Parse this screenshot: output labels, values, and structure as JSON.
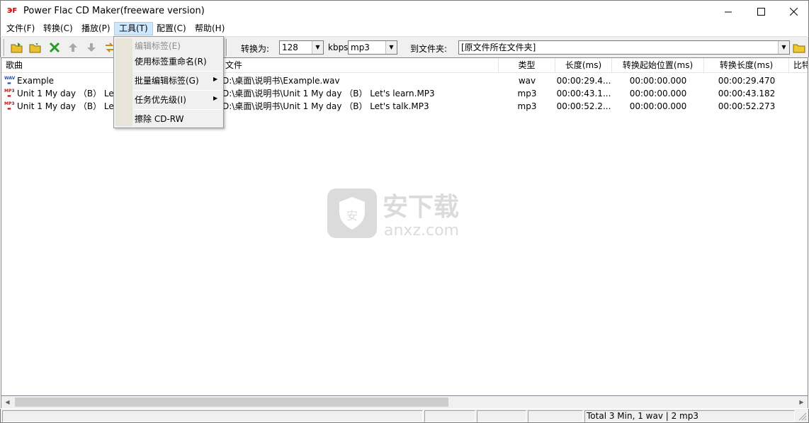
{
  "window": {
    "title": "Power Flac CD Maker(freeware version)",
    "icon_text": "ЭF",
    "minimize": "—",
    "maximize": "☐",
    "close": "✕"
  },
  "menubar": [
    {
      "label": "文件(F)"
    },
    {
      "label": "转换(C)"
    },
    {
      "label": "播放(P)"
    },
    {
      "label": "工具(T)"
    },
    {
      "label": "配置(C)"
    },
    {
      "label": "帮助(H)"
    }
  ],
  "toolbar": {
    "convert_label": "转换为:",
    "bitrate_value": "128",
    "kbps_label": "kbps",
    "format_value": "mp3",
    "folder_label": "到文件夹:",
    "folder_value": "[原文件所在文件夹]"
  },
  "tools_menu": {
    "items": [
      {
        "label": "编辑标签(E)",
        "disabled": true
      },
      {
        "label": "使用标签重命名(R)"
      },
      {
        "label": "批量编辑标签(G)",
        "submenu": true
      },
      {
        "label": "任务优先级(I)",
        "submenu": true
      },
      {
        "label": "擦除 CD-RW"
      }
    ]
  },
  "table": {
    "columns": [
      {
        "label": "歌曲"
      },
      {
        "label": "文件"
      },
      {
        "label": "类型"
      },
      {
        "label": "长度(ms)"
      },
      {
        "label": "转换起始位置(ms)"
      },
      {
        "label": "转换长度(ms)"
      },
      {
        "label": "比特"
      }
    ],
    "rows": [
      {
        "icon": "WAV",
        "song": "Example",
        "file": "D:\\桌面\\说明书\\Example.wav",
        "type": "wav",
        "length": "00:00:29.4...",
        "start": "00:00:00.000",
        "conv_length": "00:00:29.470"
      },
      {
        "icon": "MP3",
        "song": "Unit 1 My day （B） Let's learn",
        "file": "D:\\桌面\\说明书\\Unit 1 My day （B） Let's learn.MP3",
        "type": "mp3",
        "length": "00:00:43.1...",
        "start": "00:00:00.000",
        "conv_length": "00:00:43.182"
      },
      {
        "icon": "MP3",
        "song": "Unit 1 My day （B） Let's talk",
        "file": "D:\\桌面\\说明书\\Unit 1 My day （B） Let's talk.MP3",
        "type": "mp3",
        "length": "00:00:52.2...",
        "start": "00:00:00.000",
        "conv_length": "00:00:52.273"
      }
    ]
  },
  "watermark": {
    "cn": "安下载",
    "en": "anxz.com",
    "badge": "安"
  },
  "statusbar": {
    "summary": "Total 3 Min, 1 wav | 2 mp3"
  },
  "colors": {
    "menu_highlight": "#cce8ff",
    "wav_icon": "#1f4fb5",
    "mp3_icon": "#c01010"
  }
}
